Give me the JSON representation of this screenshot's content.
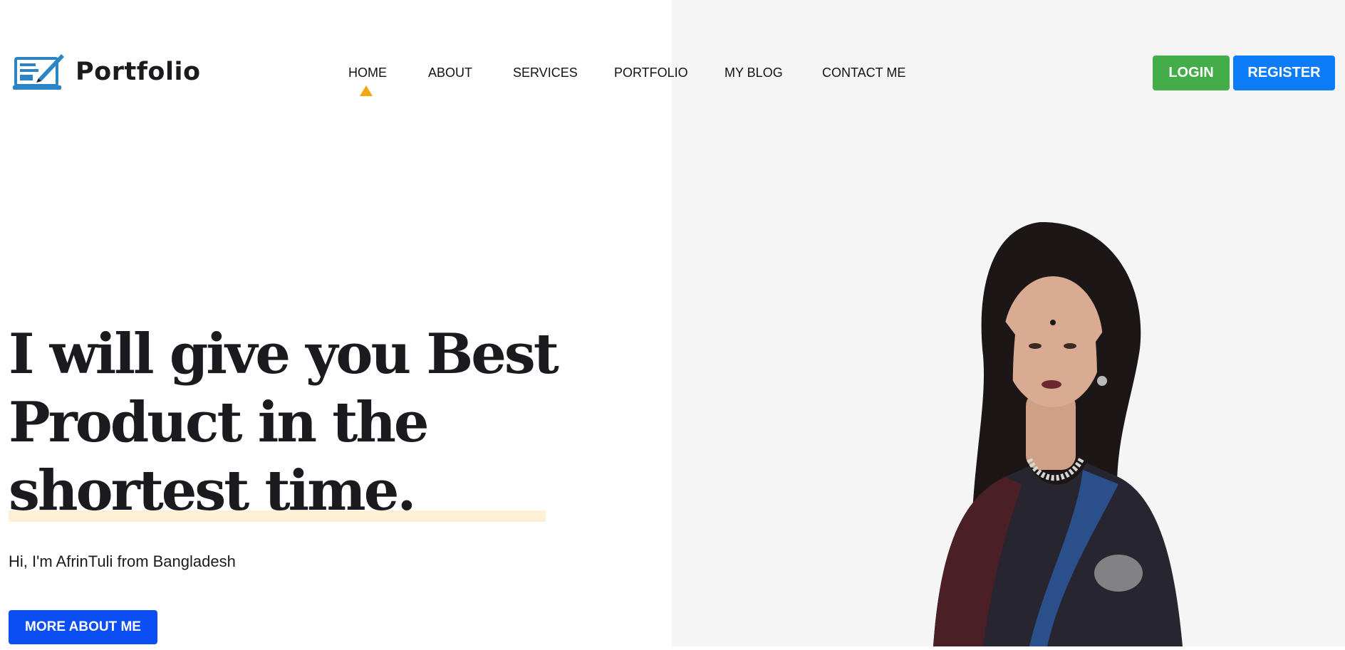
{
  "brand": {
    "name": "Portfolio",
    "icon": "laptop-pen-icon",
    "color": "#2b84c6"
  },
  "nav": {
    "items": [
      {
        "label": "HOME",
        "active": true
      },
      {
        "label": "ABOUT"
      },
      {
        "label": "SERVICES"
      },
      {
        "label": "PORTFOLIO"
      },
      {
        "label": "MY BLOG"
      },
      {
        "label": "CONTACT ME"
      }
    ],
    "indicator_color": "#f4a80f"
  },
  "auth": {
    "login_label": "LOGIN",
    "login_color": "#43ad49",
    "register_label": "REGISTER",
    "register_color": "#0d7cf9"
  },
  "hero": {
    "heading_line1": "I will give you Best",
    "heading_line2": "Product in the",
    "heading_line3": "shortest time.",
    "subtitle": "Hi, I'm AfrinTuli from Bangladesh",
    "cta_label": "MORE ABOUT ME",
    "cta_color": "#0b4ef3",
    "photo": "portrait-photo"
  }
}
